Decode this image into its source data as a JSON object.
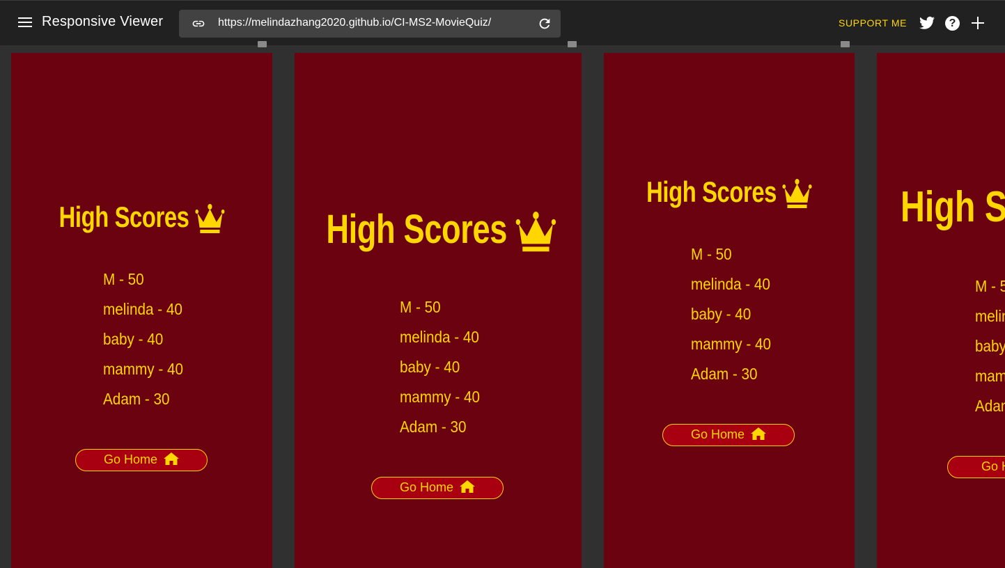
{
  "app": {
    "title": "Responsive Viewer",
    "url": "https://melindazhang2020.github.io/CI-MS2-MovieQuiz/",
    "support_label": "SUPPORT ME",
    "help_label": "?"
  },
  "page": {
    "heading": "High Scores",
    "scores": [
      "M - 50",
      "melinda - 40",
      "baby - 40",
      "mammy - 40",
      "Adam - 30"
    ],
    "home_button": "Go Home"
  },
  "colors": {
    "toolbar": "#212121",
    "canvas": "#303030",
    "page_bg": "#6a0210",
    "accent": "#ffd600",
    "button_bg": "#a80010"
  },
  "icons": [
    "menu-icon",
    "link-icon",
    "reload-icon",
    "twitter-icon",
    "help-icon",
    "plus-icon",
    "crown-icon",
    "home-icon",
    "rotate-icon"
  ]
}
